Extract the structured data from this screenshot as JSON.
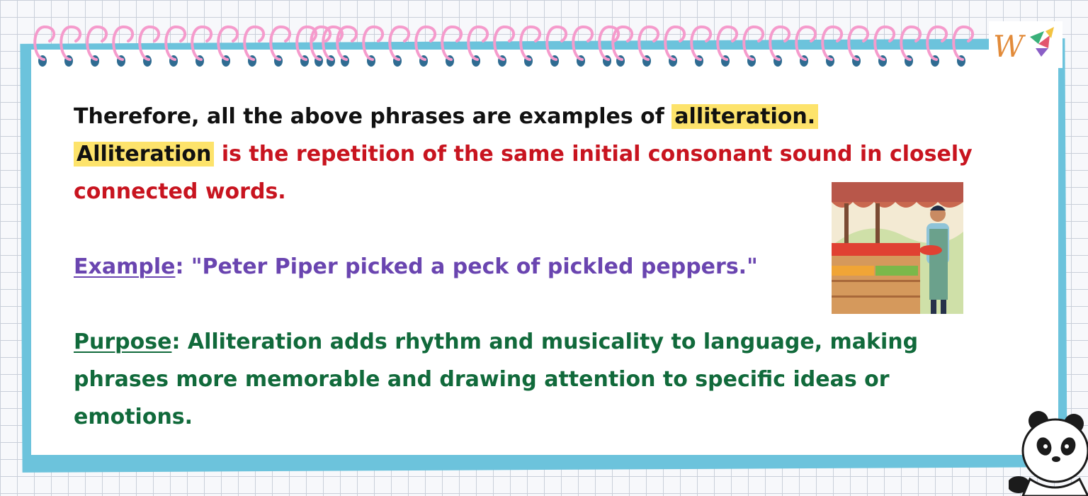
{
  "text": {
    "line1_prefix": "Therefore, all the above phrases are examples of ",
    "line1_highlight": "alliteration.",
    "definition_term": "Alliteration",
    "definition_rest": " is the repetition of the same initial consonant sound in closely connected words.",
    "example_label": "Example",
    "example_text": ": \"Peter Piper picked a peck of pickled peppers.\"",
    "purpose_label": "Purpose",
    "purpose_text": ": Alliteration adds rhythm and musicality to language, making phrases more memorable and drawing attention to specific ideas or emotions."
  },
  "logo": {
    "letter": "W"
  },
  "images": {
    "market": "market-vendor-illustration-icon",
    "panda": "panda-mascot-icon"
  },
  "colors": {
    "frame": "#6cc3dc",
    "ring": "#f59bcc",
    "slit": "#2f6c92",
    "highlight": "#fde36b",
    "red_text": "#c8141f",
    "purple_text": "#6a45b0",
    "green_text": "#116a3b"
  }
}
